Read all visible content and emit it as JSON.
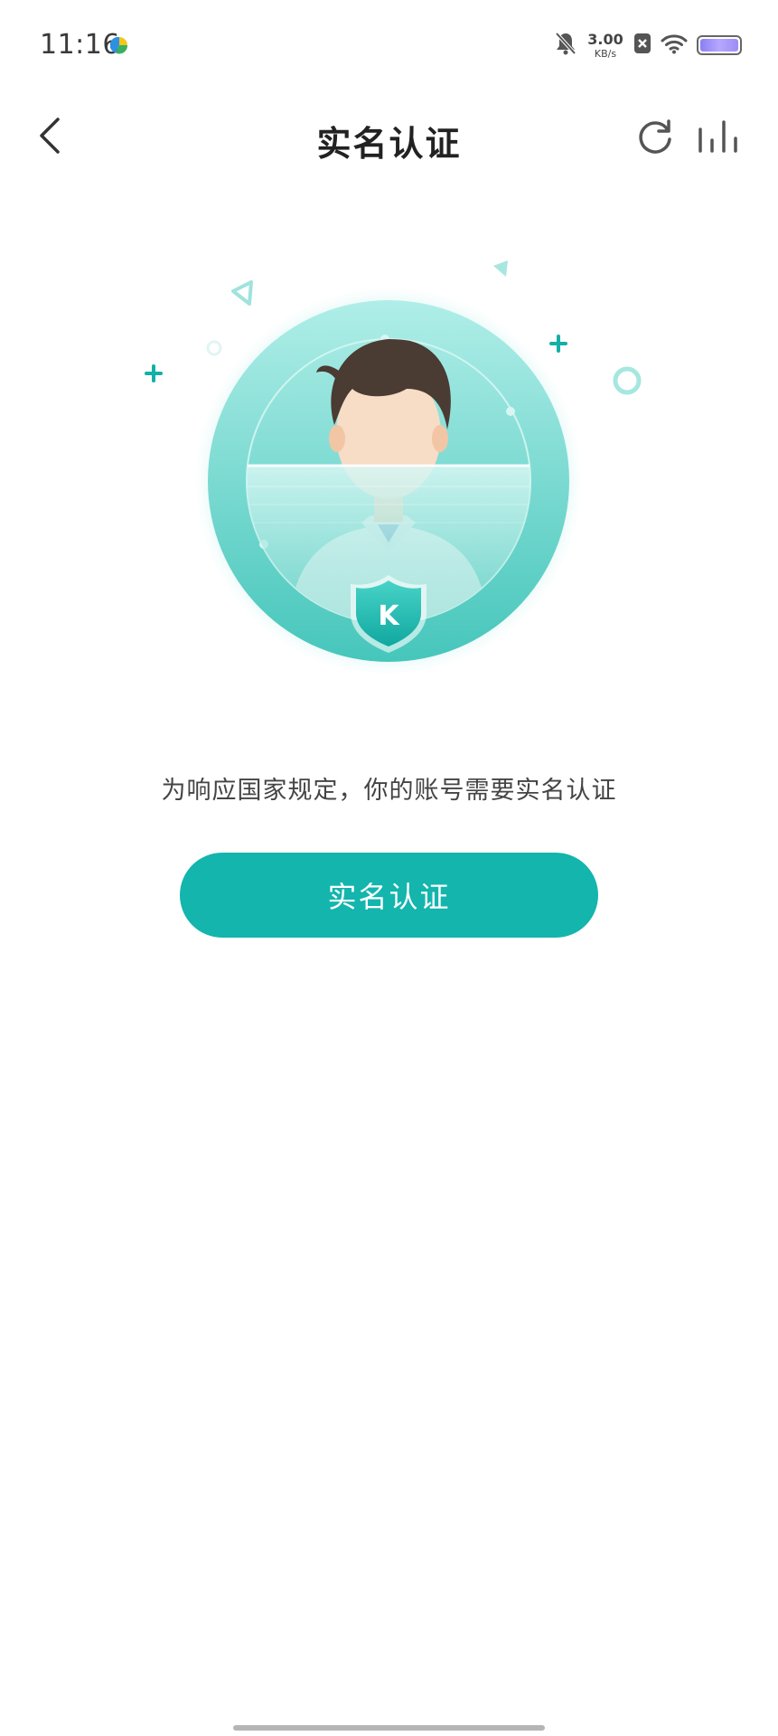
{
  "status_bar": {
    "time": "11:16",
    "net_speed_value": "3.00",
    "net_speed_unit": "KB/s",
    "icons": [
      "app-notification-icon",
      "mute-bell-icon",
      "close-box-icon",
      "wifi-icon",
      "battery-icon"
    ]
  },
  "nav": {
    "title": "实名认证",
    "back_icon": "chevron-left-icon",
    "refresh_icon": "refresh-icon",
    "stats_icon": "bar-chart-icon"
  },
  "illustration": {
    "badge_letter": "K"
  },
  "main": {
    "prompt": "为响应国家规定，你的账号需要实名认证",
    "button_label": "实名认证"
  },
  "colors": {
    "accent": "#13b5ad",
    "circle_light": "#a6ebe5",
    "circle_dark": "#4fcac0"
  }
}
